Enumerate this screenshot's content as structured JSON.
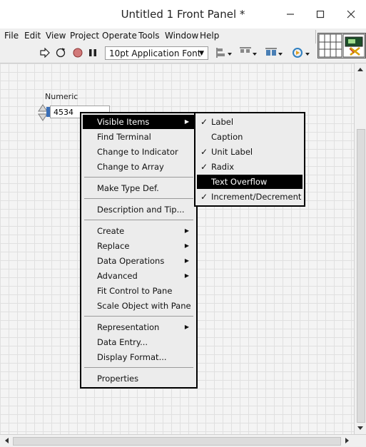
{
  "window": {
    "title": "Untitled 1 Front Panel *"
  },
  "menubar": {
    "items": [
      "File",
      "Edit",
      "View",
      "Project",
      "Operate",
      "Tools",
      "Window",
      "Help"
    ]
  },
  "toolbar": {
    "font": "10pt Application Font"
  },
  "control": {
    "label": "Numeric",
    "value": "4534"
  },
  "context_menu": {
    "items": [
      {
        "label": "Visible Items"
      },
      {
        "label": "Find Terminal"
      },
      {
        "label": "Change to Indicator"
      },
      {
        "label": "Change to Array"
      },
      {
        "label": "Make Type Def."
      },
      {
        "label": "Description and Tip..."
      },
      {
        "label": "Create"
      },
      {
        "label": "Replace"
      },
      {
        "label": "Data Operations"
      },
      {
        "label": "Advanced"
      },
      {
        "label": "Fit Control to Pane"
      },
      {
        "label": "Scale Object with Pane"
      },
      {
        "label": "Representation"
      },
      {
        "label": "Data Entry..."
      },
      {
        "label": "Display Format..."
      },
      {
        "label": "Properties"
      }
    ]
  },
  "submenu": {
    "items": [
      {
        "label": "Label",
        "checked": true
      },
      {
        "label": "Caption",
        "checked": false
      },
      {
        "label": "Unit Label",
        "checked": true
      },
      {
        "label": "Radix",
        "checked": true
      },
      {
        "label": "Text Overflow",
        "checked": false
      },
      {
        "label": "Increment/Decrement",
        "checked": true
      }
    ]
  }
}
